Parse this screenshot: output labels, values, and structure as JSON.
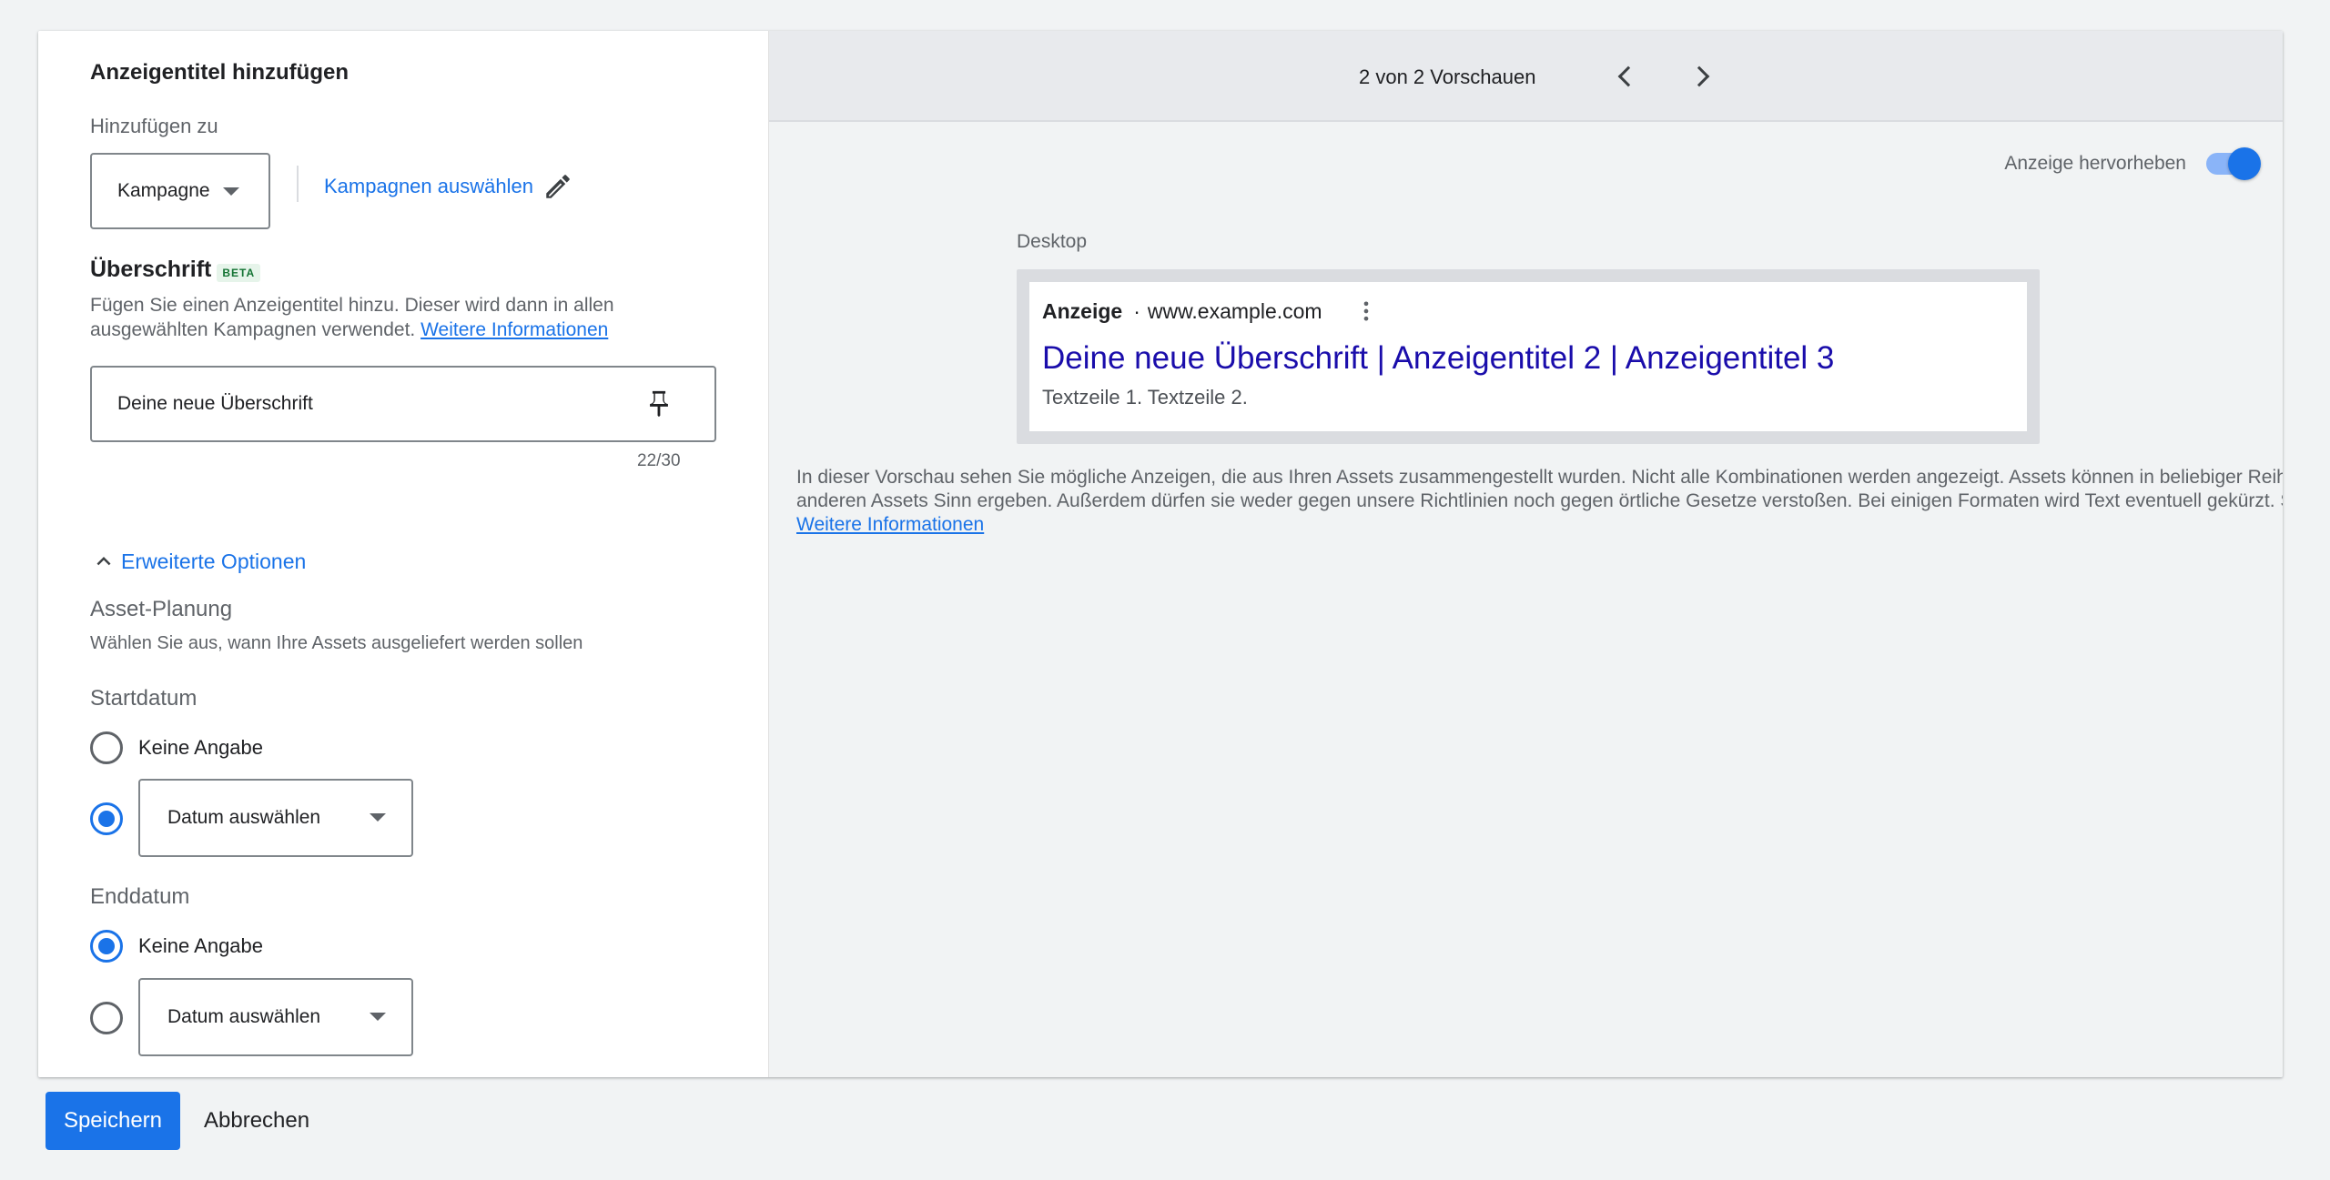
{
  "form": {
    "title": "Anzeigentitel hinzufügen",
    "add_to_label": "Hinzufügen zu",
    "scope_select": {
      "value": "Kampagne"
    },
    "select_campaigns_link": "Kampagnen auswählen",
    "headline_section": {
      "title": "Überschrift",
      "badge": "BETA",
      "description": "Fügen Sie einen Anzeigentitel hinzu. Dieser wird dann in allen ausgewählten Kampagnen verwendet.",
      "learn_more": "Weitere Informationen",
      "input_value": "Deine neue Überschrift",
      "char_counter": "22/30"
    },
    "advanced": {
      "toggle_label": "Erweiterte Optionen",
      "asset_planning_title": "Asset-Planung",
      "asset_planning_desc": "Wählen Sie aus, wann Ihre Assets ausgeliefert werden sollen",
      "start": {
        "title": "Startdatum",
        "option_none": "Keine Angabe",
        "option_date": "Datum auswählen",
        "selected": "date"
      },
      "end": {
        "title": "Enddatum",
        "option_none": "Keine Angabe",
        "option_date": "Datum auswählen",
        "selected": "none"
      }
    }
  },
  "preview": {
    "nav_text": "2 von 2 Vorschauen",
    "highlight_toggle_label": "Anzeige hervorheben",
    "highlight_on": true,
    "device_label": "Desktop",
    "ad": {
      "ad_label": "Anzeige",
      "separator": "·",
      "url": "www.example.com",
      "headline": "Deine neue Überschrift | Anzeigentitel 2 | Anzeigentitel 3",
      "description": "Textzeile 1. Textzeile 2."
    },
    "info_text": "In dieser Vorschau sehen Sie mögliche Anzeigen, die aus Ihren Assets zusammengestellt wurden. Nicht alle Kombinationen werden angezeigt. Assets können in beliebiger Reihenfolge erscheinen. Sie müssen daher sowohl einzeln als auch in Kombination mit anderen Assets Sinn ergeben. Außerdem dürfen sie weder gegen unsere Richtlinien noch gegen örtliche Gesetze verstoßen. Bei einigen Formaten wird Text eventuell gekürzt. Sie können sicherstellen, dass bestimmte Textteile in der Anzeige erscheinen.",
    "info_link": "Weitere Informationen"
  },
  "footer": {
    "save_label": "Speichern",
    "cancel_label": "Abbrechen"
  },
  "colors": {
    "primary": "#1a73e8",
    "ad_headline": "#1a0dab",
    "panel_bg": "#f1f3f4"
  },
  "icons": [
    "caret-down-icon",
    "pencil-icon",
    "pin-icon",
    "chevron-up-icon",
    "chevron-left-icon",
    "chevron-right-icon",
    "more-vert-icon"
  ]
}
